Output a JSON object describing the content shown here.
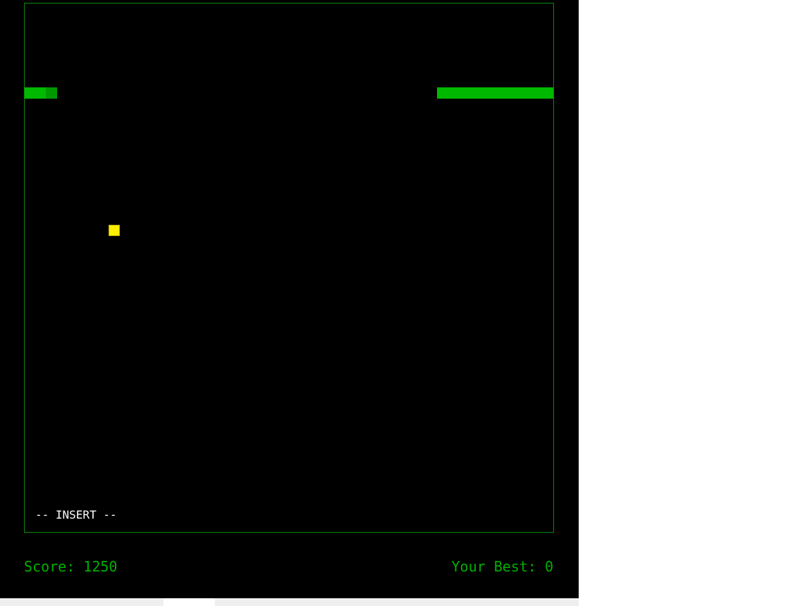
{
  "game": {
    "mode_text": "-- INSERT --",
    "score_label": "Score: ",
    "score_value": "1250",
    "best_label": "Your Best: ",
    "best_value": "0"
  },
  "colors": {
    "background": "#000000",
    "border": "#0a8a0a",
    "snake": "#00b800",
    "food": "#ffee00",
    "hud_text": "#00b000",
    "mode_text": "#ffffff"
  }
}
